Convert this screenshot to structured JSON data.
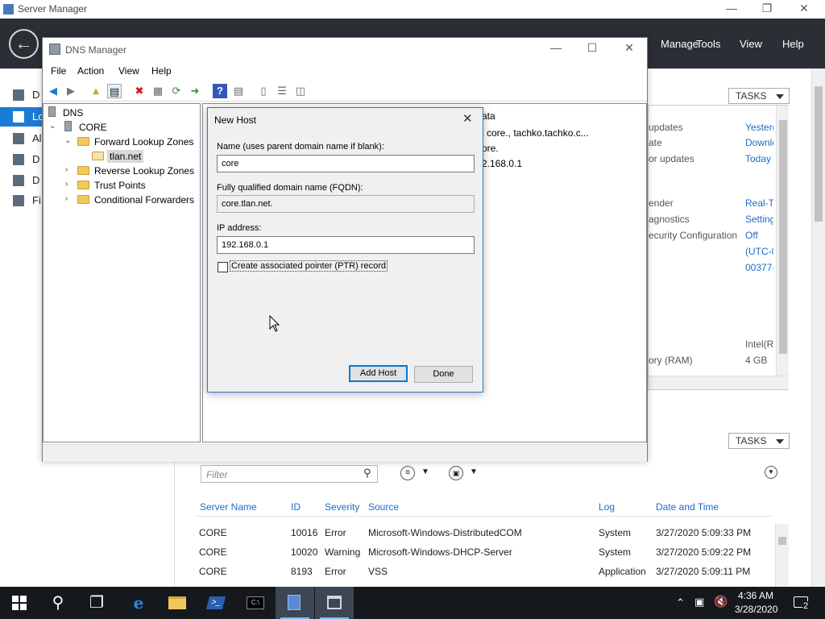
{
  "server_manager": {
    "title": "Server Manager",
    "menu": [
      "Manage",
      "Tools",
      "View",
      "Help"
    ],
    "nav": [
      "D",
      "Lo",
      "Al",
      "D",
      "D",
      "Fi"
    ],
    "tasks_label": "TASKS",
    "properties": [
      {
        "label": "updates",
        "value": "Yesterd",
        "link": true
      },
      {
        "label": "ate",
        "value": "Downlo",
        "link": true
      },
      {
        "label": "or updates",
        "value": "Today a",
        "link": true
      },
      {
        "label": "ender",
        "value": "Real-Ti",
        "link": true
      },
      {
        "label": "agnostics",
        "value": "Setting",
        "link": true
      },
      {
        "label": "ecurity Configuration",
        "value": "Off",
        "link": true
      },
      {
        "label": "",
        "value": "(UTC-0",
        "link": true
      },
      {
        "label": "",
        "value": "00377-",
        "link": true
      },
      {
        "label": "",
        "value": "Intel(R)",
        "link": false
      },
      {
        "label": "ory (RAM)",
        "value": "4 GB",
        "link": false
      }
    ],
    "events": {
      "filter_placeholder": "Filter",
      "columns": [
        "Server Name",
        "ID",
        "Severity",
        "Source",
        "Log",
        "Date and Time"
      ],
      "rows": [
        [
          "CORE",
          "10016",
          "Error",
          "Microsoft-Windows-DistributedCOM",
          "System",
          "3/27/2020 5:09:33 PM"
        ],
        [
          "CORE",
          "10020",
          "Warning",
          "Microsoft-Windows-DHCP-Server",
          "System",
          "3/27/2020 5:09:22 PM"
        ],
        [
          "CORE",
          "8193",
          "Error",
          "VSS",
          "Application",
          "3/27/2020 5:09:11 PM"
        ]
      ]
    }
  },
  "dns_manager": {
    "title": "DNS Manager",
    "menu": [
      "File",
      "Action",
      "View",
      "Help"
    ],
    "tree": {
      "root": "DNS",
      "server": "CORE",
      "forward": "Forward Lookup Zones",
      "zone": "tlan.net",
      "reverse": "Reverse Lookup Zones",
      "trust": "Trust Points",
      "conditional": "Conditional Forwarders"
    },
    "right_pane": {
      "header": "ata",
      "row1": "], core., tachko.tachko.c...",
      "row2": "ore.",
      "row3": "2.168.0.1"
    }
  },
  "new_host_dialog": {
    "title": "New Host",
    "name_label": "Name (uses parent domain name if blank):",
    "name_value": "core",
    "fqdn_label": "Fully qualified domain name (FQDN):",
    "fqdn_value": "core.tlan.net.",
    "ip_label": "IP address:",
    "ip_value": "192.168.0.1",
    "ptr_label": "Create associated pointer (PTR) record",
    "ptr_checked": false,
    "add_host_label": "Add Host",
    "done_label": "Done"
  },
  "taskbar": {
    "time": "4:36 AM",
    "date": "3/28/2020",
    "notification_count": "2"
  }
}
